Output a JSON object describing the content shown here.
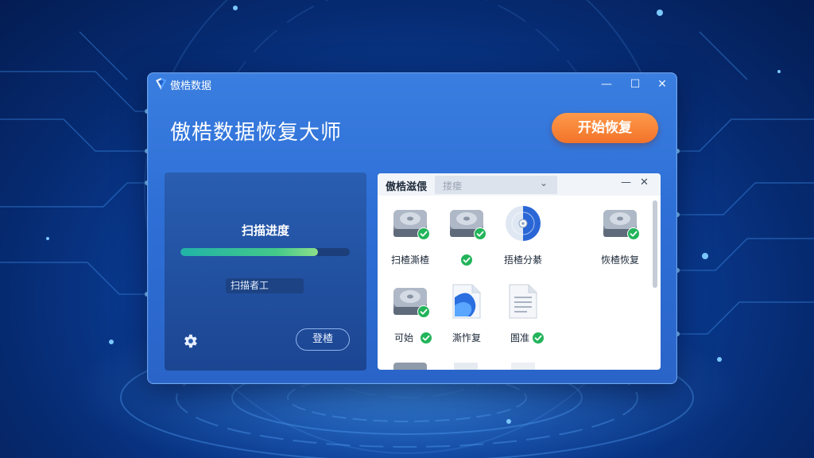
{
  "window": {
    "app_name": "傲梏数据",
    "title": "傲梏数据恢复大师",
    "start_button": "开始恢复",
    "controls": {
      "minimize": "—",
      "maximize": "☐",
      "close": "✕"
    }
  },
  "scan_panel": {
    "title": "扫描进度",
    "progress": 0.81,
    "status": "扫描者工",
    "login_button": "登楂",
    "progress_colors": [
      "#22b3a8",
      "#8de08a"
    ]
  },
  "file_panel": {
    "title": "傲梏滋偎",
    "search_placeholder": "搂瘘",
    "controls": {
      "minimize": "—",
      "close": "✕"
    },
    "items": [
      {
        "label": "扫楂澌楂",
        "icon": "hard-drive-icon",
        "checked": true
      },
      {
        "label": "",
        "icon": "hard-drive-icon",
        "checked": true
      },
      {
        "label": "捂楂分綦",
        "icon": "disc-icon",
        "checked": false
      },
      {
        "label": "恢楂恢复",
        "icon": "hard-drive-icon",
        "checked": true
      },
      {
        "label": "可始",
        "icon": "hard-drive-icon",
        "checked": true
      },
      {
        "label": "澌怍复",
        "icon": "photo-file-icon",
        "checked": false
      },
      {
        "label": "圄准",
        "icon": "document-file-icon",
        "checked": true
      }
    ]
  },
  "colors": {
    "accent_orange": "#f2732a",
    "window_blue": "#2e6fd6",
    "check_green": "#22b45a"
  }
}
